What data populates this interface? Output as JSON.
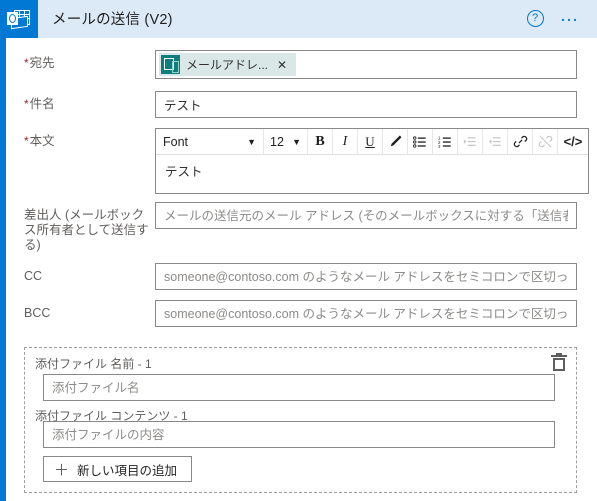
{
  "header": {
    "app_icon": "outlook-icon",
    "title": "メールの送信 (V2)",
    "help_icon": "help-circle-icon",
    "more_icon": "ellipsis-icon",
    "accent_color": "#0078d4",
    "background_color": "#dce9f7"
  },
  "form": {
    "to": {
      "label": "宛先",
      "required": true,
      "token": {
        "icon": "office365-users-icon",
        "text": "メールアドレ...",
        "remove_label": "✕",
        "icon_color": "#0f7d7d",
        "chip_color": "#d9e8e6"
      }
    },
    "subject": {
      "label": "件名",
      "required": true,
      "value": "テスト",
      "placeholder": ""
    },
    "body": {
      "label": "本文",
      "required": true,
      "value": "テスト",
      "toolbar": {
        "font_name": "Font",
        "font_size": "12",
        "bold": "B",
        "italic": "I",
        "underline": "U",
        "highlight_icon": "pen-highlight-icon",
        "bullet_list_icon": "bulleted-list-icon",
        "numbered_list_icon": "numbered-list-icon",
        "indent_icon": "indent-increase-icon",
        "outdent_icon": "indent-decrease-icon",
        "link_icon": "link-icon",
        "unlink_icon": "unlink-icon",
        "code_label": "</>"
      }
    },
    "from": {
      "label": "差出人 (メールボックス所有者として送信する)",
      "required": false,
      "value": "",
      "placeholder": "メールの送信元のメール アドレス (そのメールボックスに対する「送信者」または「イ"
    },
    "cc": {
      "label": "CC",
      "required": false,
      "value": "",
      "placeholder": "someone@contoso.com のようなメール アドレスをセミコロンで区切って指定し"
    },
    "bcc": {
      "label": "BCC",
      "required": false,
      "value": "",
      "placeholder": "someone@contoso.com のようなメール アドレスをセミコロンで区切って指定し"
    }
  },
  "attachments": {
    "delete_icon": "trash-icon",
    "name": {
      "label": "添付ファイル 名前 - 1",
      "value": "",
      "placeholder": "添付ファイル名"
    },
    "content": {
      "label": "添付ファイル コンテンツ - 1",
      "value": "",
      "placeholder": "添付ファイルの内容"
    },
    "add_button": {
      "plus": "＋",
      "label": "新しい項目の追加"
    }
  }
}
